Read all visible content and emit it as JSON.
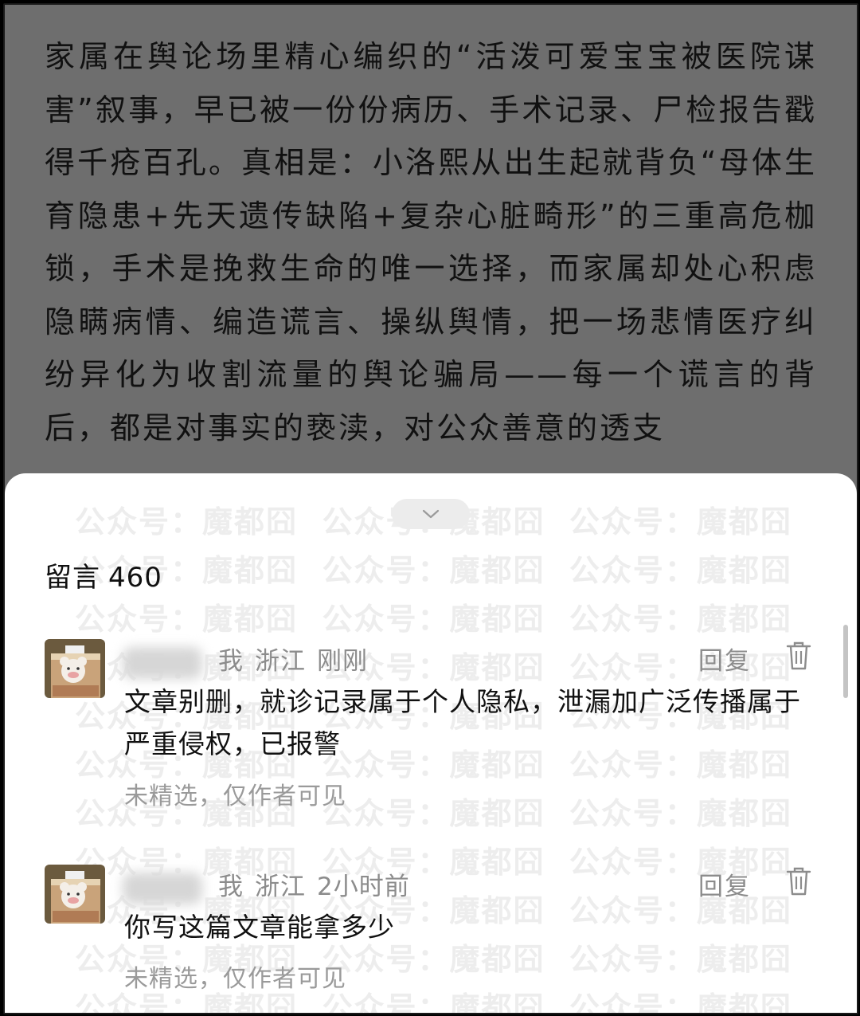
{
  "article": {
    "text": "家属在舆论场里精心编织的“活泼可爱宝宝被医院谋害”叙事，早已被一份份病历、手术记录、尸检报告戳得千疮百孔。真相是：小洛熙从出生起就背负“母体生育隐患+先天遗传缺陷+复杂心脏畸形”的三重高危枷锁，手术是挽救生命的唯一选择，而家属却处心积虑隐瞒病情、编造谎言、操纵舆情，把一场悲情医疗纠纷异化为收割流量的舆论骗局——每一个谎言的背后，都是对事实的亵渎，对公众善意的透支"
  },
  "sheet": {
    "collapse_icon": "chevron-down-icon",
    "title": "留言",
    "count": "460",
    "watermark_text": "公众号：魔都囧"
  },
  "comments": [
    {
      "avatar_icon": "bear-box-avatar",
      "author_tag": "我",
      "location": "浙江",
      "time": "刚刚",
      "reply_label": "回复",
      "delete_icon": "trash-icon",
      "text": "文章别删，就诊记录属于个人隐私，泄漏加广泛传播属于严重侵权，已报警",
      "status": "未精选，仅作者可见"
    },
    {
      "avatar_icon": "bear-box-avatar",
      "author_tag": "我",
      "location": "浙江",
      "time": "2小时前",
      "reply_label": "回复",
      "delete_icon": "trash-icon",
      "text": "你写这篇文章能拿多少",
      "status": "未精选，仅作者可见"
    }
  ]
}
